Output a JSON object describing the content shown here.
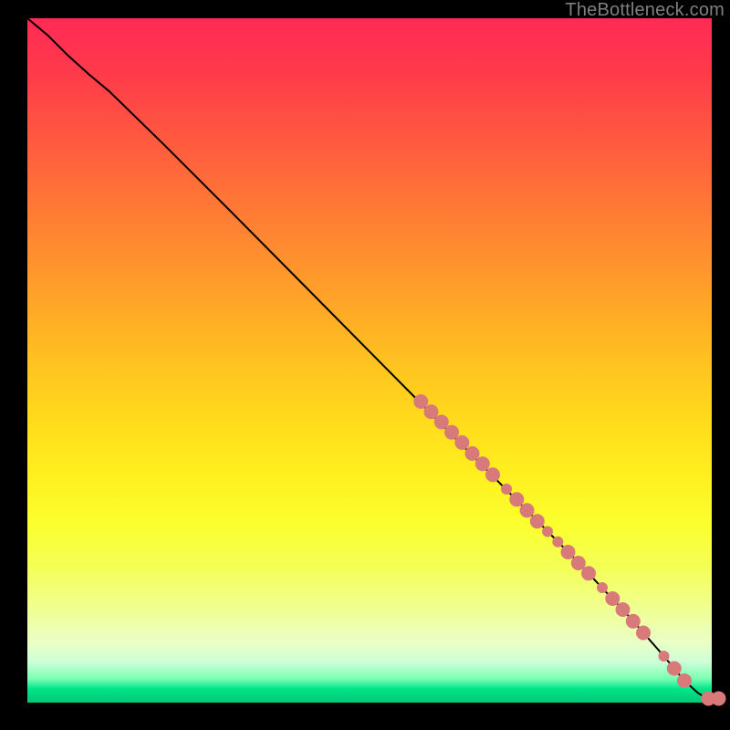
{
  "attribution": "TheBottleneck.com",
  "chart_data": {
    "type": "line",
    "title": "",
    "xlabel": "",
    "ylabel": "",
    "xlim": [
      0,
      100
    ],
    "ylim": [
      0,
      100
    ],
    "grid": false,
    "legend": false,
    "series": [
      {
        "name": "curve",
        "stroke": "#000000",
        "stroke_width": 2,
        "points": [
          {
            "x": 0,
            "y": 100
          },
          {
            "x": 3,
            "y": 97.5
          },
          {
            "x": 6,
            "y": 94.5
          },
          {
            "x": 9,
            "y": 91.8
          },
          {
            "x": 12,
            "y": 89.3
          },
          {
            "x": 20,
            "y": 81.5
          },
          {
            "x": 30,
            "y": 71.5
          },
          {
            "x": 40,
            "y": 61.4
          },
          {
            "x": 50,
            "y": 51.3
          },
          {
            "x": 60,
            "y": 41.2
          },
          {
            "x": 70,
            "y": 31.1
          },
          {
            "x": 80,
            "y": 21.0
          },
          {
            "x": 88,
            "y": 12.5
          },
          {
            "x": 93,
            "y": 6.8
          },
          {
            "x": 96,
            "y": 3.2
          },
          {
            "x": 98,
            "y": 1.4
          },
          {
            "x": 99,
            "y": 0.8
          },
          {
            "x": 100,
            "y": 0.6
          }
        ]
      }
    ],
    "scatter": {
      "name": "markers",
      "color": "#d97a7a",
      "r_small": 6,
      "r_large": 8,
      "points": [
        {
          "x": 57.5,
          "y": 44.0,
          "r": 8
        },
        {
          "x": 59.0,
          "y": 42.5,
          "r": 8
        },
        {
          "x": 60.5,
          "y": 41.0,
          "r": 8
        },
        {
          "x": 62.0,
          "y": 39.5,
          "r": 8
        },
        {
          "x": 63.5,
          "y": 38.0,
          "r": 8
        },
        {
          "x": 65.0,
          "y": 36.4,
          "r": 8
        },
        {
          "x": 66.5,
          "y": 34.9,
          "r": 8
        },
        {
          "x": 68.0,
          "y": 33.3,
          "r": 8
        },
        {
          "x": 70.0,
          "y": 31.2,
          "r": 6
        },
        {
          "x": 71.5,
          "y": 29.7,
          "r": 8
        },
        {
          "x": 73.0,
          "y": 28.1,
          "r": 8
        },
        {
          "x": 74.5,
          "y": 26.5,
          "r": 8
        },
        {
          "x": 76.0,
          "y": 25.0,
          "r": 6
        },
        {
          "x": 77.5,
          "y": 23.5,
          "r": 6
        },
        {
          "x": 79.0,
          "y": 22.0,
          "r": 8
        },
        {
          "x": 80.5,
          "y": 20.4,
          "r": 8
        },
        {
          "x": 82.0,
          "y": 18.9,
          "r": 8
        },
        {
          "x": 84.0,
          "y": 16.8,
          "r": 6
        },
        {
          "x": 85.5,
          "y": 15.2,
          "r": 8
        },
        {
          "x": 87.0,
          "y": 13.6,
          "r": 8
        },
        {
          "x": 88.5,
          "y": 11.9,
          "r": 8
        },
        {
          "x": 90.0,
          "y": 10.2,
          "r": 8
        },
        {
          "x": 93.0,
          "y": 6.8,
          "r": 6
        },
        {
          "x": 94.5,
          "y": 5.0,
          "r": 8
        },
        {
          "x": 96.0,
          "y": 3.2,
          "r": 8
        },
        {
          "x": 99.5,
          "y": 0.6,
          "r": 8
        },
        {
          "x": 101.0,
          "y": 0.6,
          "r": 8
        }
      ]
    }
  }
}
